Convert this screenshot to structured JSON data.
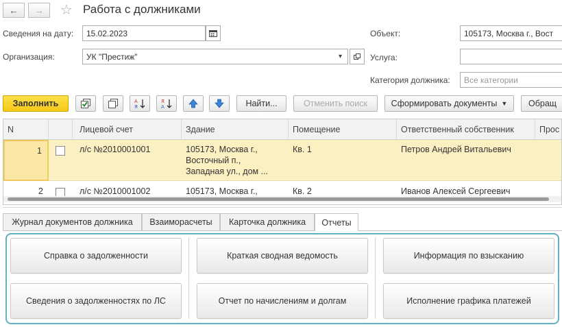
{
  "header": {
    "title": "Работа с должниками",
    "back_icon": "←",
    "forward_icon": "→",
    "star_icon": "☆"
  },
  "filters": {
    "date_label": "Сведения на дату:",
    "date_value": "15.02.2023",
    "org_label": "Организация:",
    "org_value": "УК \"Престиж\"",
    "object_label": "Объект:",
    "object_value": "105173, Москва г., Вост",
    "service_label": "Услуга:",
    "service_value": "",
    "category_label": "Категория должника:",
    "category_placeholder": "Все категории"
  },
  "toolbar": {
    "fill": "Заполнить",
    "find": "Найти...",
    "cancel_search": "Отменить поиск",
    "generate_docs": "Сформировать документы",
    "appeal": "Обращ"
  },
  "table": {
    "columns": [
      "N",
      "",
      "Лицевой счет",
      "Здание",
      "Помещение",
      "Ответственный собственник",
      "Прос"
    ],
    "rows": [
      {
        "n": "1",
        "account": "л/с №2010001001",
        "building_lines": [
          "105173, Москва г.,",
          "Восточный п.,",
          "Западная ул., дом ..."
        ],
        "room": "Кв. 1",
        "owner": "Петров Андрей Витальевич"
      },
      {
        "n": "2",
        "account": "л/с №2010001002",
        "building_lines": [
          "105173, Москва г.,"
        ],
        "room": "Кв. 2",
        "owner": "Иванов Алексей Сергеевич"
      }
    ]
  },
  "tabs": [
    "Журнал документов должника",
    "Взаиморасчеты",
    "Карточка должника",
    "Отчеты"
  ],
  "reports": {
    "debt_certificate": "Справка о задолженности",
    "debt_by_accounts": "Сведения о задолженностях по ЛС",
    "summary_sheet": "Краткая сводная ведомость",
    "charges_report": "Отчет по начислениям и долгам",
    "collection_info": "Информация по взысканию",
    "payment_schedule": "Исполнение графика платежей"
  },
  "colors": {
    "primary_button": "#f5c816",
    "selected_row": "#fbf0c2",
    "panel_border": "#5fb2c0"
  }
}
